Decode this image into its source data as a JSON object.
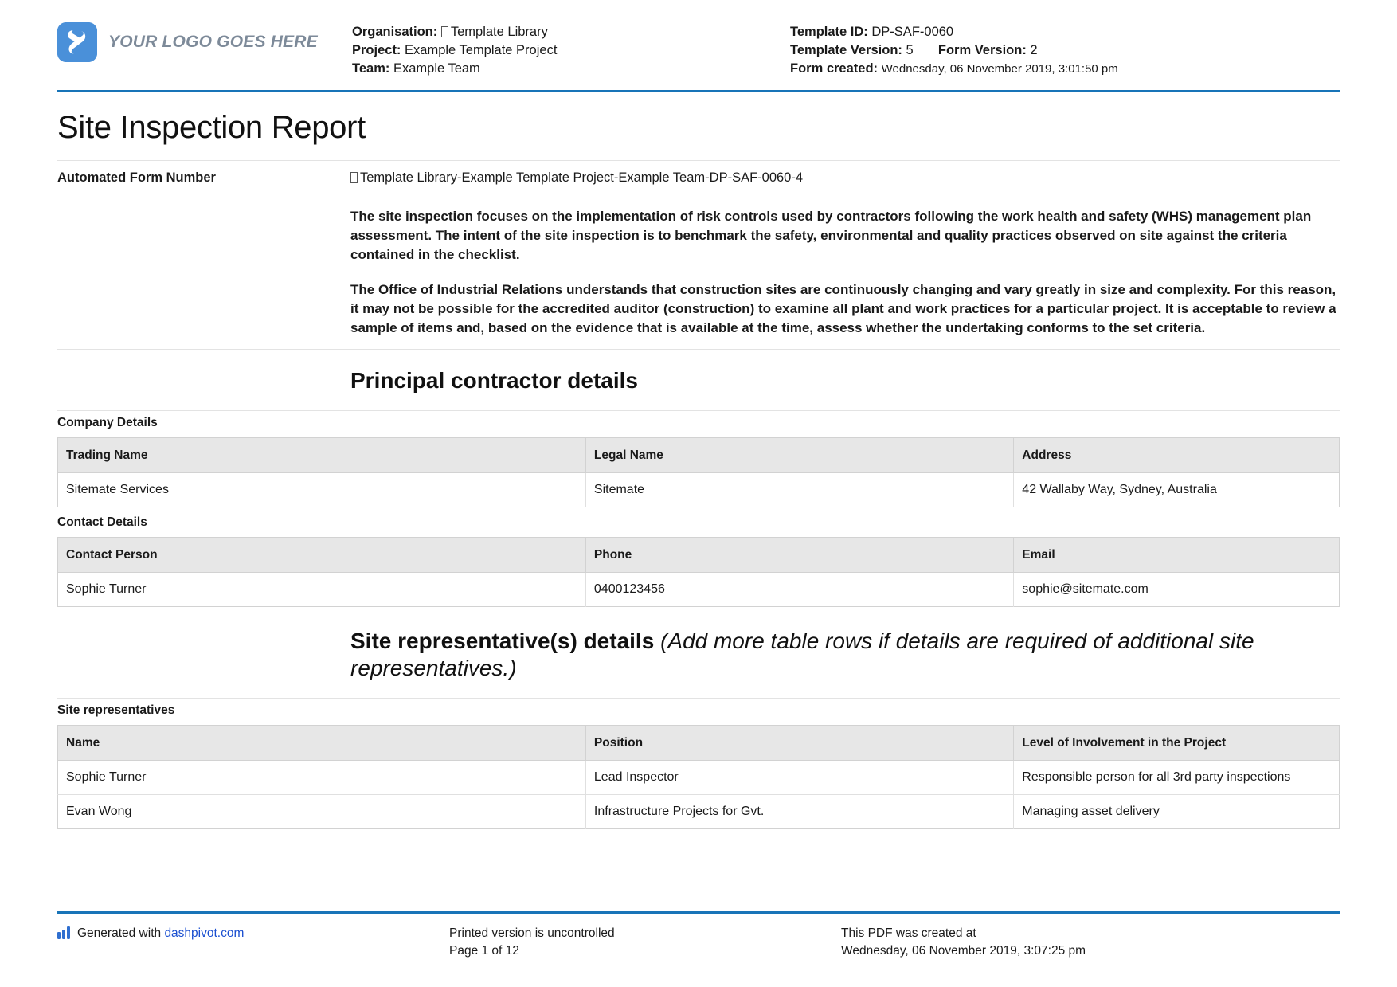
{
  "header": {
    "logo_text": "YOUR LOGO GOES HERE",
    "left_meta": [
      {
        "label": "Organisation:",
        "value": "Template Library",
        "tofu": true
      },
      {
        "label": "Project:",
        "value": "Example Template Project",
        "tofu": false
      },
      {
        "label": "Team:",
        "value": "Example Team",
        "tofu": false
      }
    ],
    "right_meta": {
      "template_id_label": "Template ID:",
      "template_id_value": "DP-SAF-0060",
      "template_version_label": "Template Version:",
      "template_version_value": "5",
      "form_version_label": "Form Version:",
      "form_version_value": "2",
      "form_created_label": "Form created:",
      "form_created_value": "Wednesday, 06 November 2019, 3:01:50 pm"
    }
  },
  "title": "Site Inspection Report",
  "automated_form": {
    "label": "Automated Form Number",
    "value": "Template Library-Example Template Project-Example Team-DP-SAF-0060-4"
  },
  "intro": {
    "paragraph_1": "The site inspection focuses on the implementation of risk controls used by contractors following the work health and safety (WHS) management plan assessment. The intent of the site inspection is to benchmark the safety, environmental and quality practices observed on site against the criteria contained in the checklist.",
    "paragraph_2": "The Office of Industrial Relations understands that construction sites are continuously changing and vary greatly in size and complexity. For this reason, it may not be possible for the accredited auditor (construction) to examine all plant and work practices for a particular project. It is acceptable to review a sample of items and, based on the evidence that is available at the time, assess whether the undertaking conforms to the set criteria."
  },
  "sections": {
    "principal_contractor": "Principal contractor details",
    "site_representatives_heading": "Site representative(s) details",
    "site_representatives_note": "(Add more table rows if details are required of additional site representatives.)"
  },
  "tables": {
    "company_details": {
      "caption": "Company Details",
      "columns": [
        "Trading Name",
        "Legal Name",
        "Address"
      ],
      "rows": [
        [
          "Sitemate Services",
          "Sitemate",
          "42 Wallaby Way, Sydney, Australia"
        ]
      ]
    },
    "contact_details": {
      "caption": "Contact Details",
      "columns": [
        "Contact Person",
        "Phone",
        "Email"
      ],
      "rows": [
        [
          "Sophie Turner",
          "0400123456",
          "sophie@sitemate.com"
        ]
      ]
    },
    "site_representatives": {
      "caption": "Site representatives",
      "columns": [
        "Name",
        "Position",
        "Level of Involvement in the Project"
      ],
      "rows": [
        [
          "Sophie Turner",
          "Lead Inspector",
          "Responsible person for all 3rd party inspections"
        ],
        [
          "Evan Wong",
          "Infrastructure Projects for Gvt.",
          "Managing asset delivery"
        ]
      ]
    }
  },
  "footer": {
    "generated_prefix": "Generated with ",
    "generated_link": "dashpivot.com",
    "printed_line_1": "Printed version is uncontrolled",
    "printed_line_2": "Page 1 of 12",
    "pdf_line_1": "This PDF was created at",
    "pdf_line_2": "Wednesday, 06 November 2019, 3:07:25 pm"
  },
  "colors": {
    "accent_blue": "#1874b8",
    "logo_blue": "#4a90d9",
    "link_blue": "#1a4fd0",
    "table_header_gray": "#e7e7e7"
  }
}
